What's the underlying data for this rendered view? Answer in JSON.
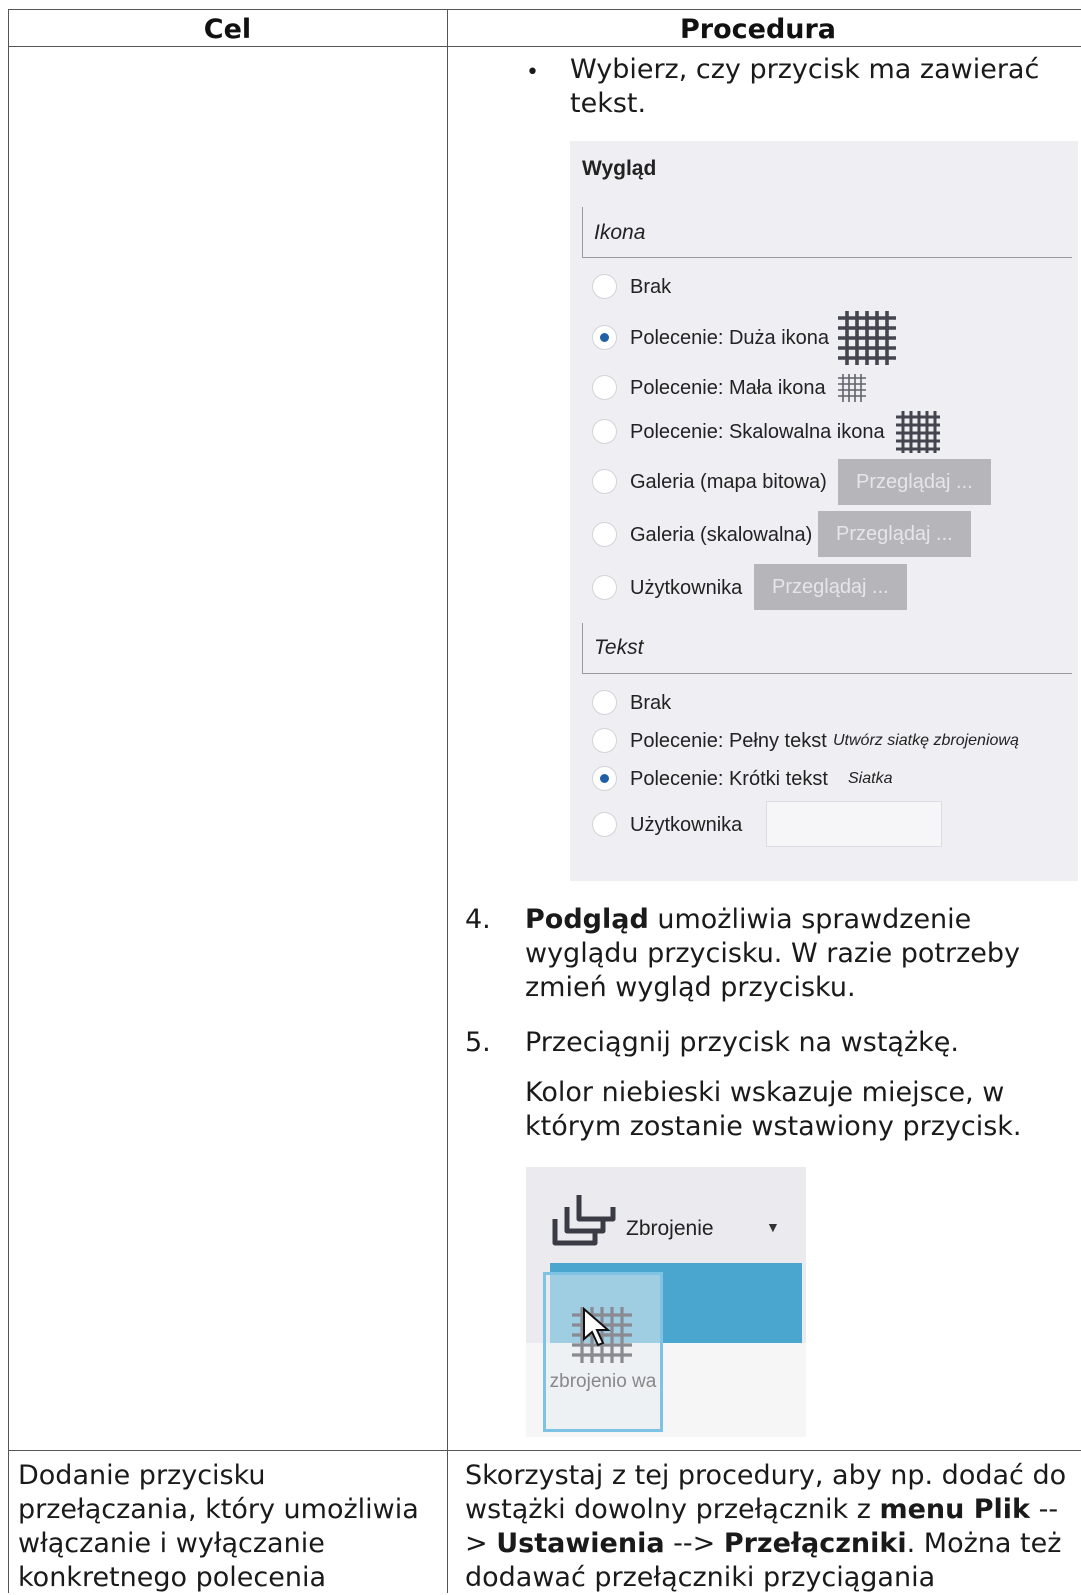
{
  "table": {
    "header_goal": "Cel",
    "header_procedure": "Procedura"
  },
  "bullet": {
    "text": "Wybierz, czy przycisk ma zawierać tekst."
  },
  "panel": {
    "title": "Wygląd",
    "icon_group": "Ikona",
    "icon_options": [
      "Brak",
      "Polecenie: Duża ikona",
      "Polecenie: Mała ikona",
      "Polecenie: Skalowalna ikona",
      "Galeria (mapa bitowa)",
      "Galeria (skalowalna)",
      "Użytkownika"
    ],
    "icon_selected": 1,
    "browse_label": "Przeglądaj ...",
    "text_group": "Tekst",
    "text_options": [
      "Brak",
      "Polecenie: Pełny tekst",
      "Polecenie: Krótki tekst",
      "Użytkownika"
    ],
    "text_selected": 2,
    "full_text_preview": "Utwórz siatkę zbrojeniową",
    "short_text_preview": "Siatka"
  },
  "steps": [
    {
      "number": "4.",
      "bold": "Podgląd",
      "text": " umożliwia sprawdzenie wyglądu przycisku. W razie potrzeby zmień wygląd przycisku."
    },
    {
      "number": "5.",
      "text": "Przeciągnij przycisk na wstążkę.",
      "note": "Kolor niebieski wskazuje miejsce, w którym zostanie wstawiony przycisk."
    }
  ],
  "ribbon": {
    "label": "Zbrojenie",
    "ghost_label": "zbrojenio wa",
    "icons": [
      "reinforcement-icon",
      "mesh-grid-icon",
      "mouse-pointer-icon",
      "dropdown-arrow-icon"
    ]
  },
  "row2": {
    "goal": "Dodanie przycisku przełączania, który umożliwia włączanie i wyłączanie konkretnego polecenia",
    "proc_parts": [
      "Skorzystaj z tej procedury, aby np. dodać do wstążki dowolny przełącznik z ",
      "menu Plik",
      " --> ",
      "Ustawienia",
      " --> ",
      "Przełączniki",
      ". Można też dodawać przełączniki przyciągania"
    ]
  },
  "colors": {
    "radio_selected": "#1f5fa6",
    "ribbon_highlight": "#4aa6cf",
    "panel_bg": "#efeff3"
  }
}
